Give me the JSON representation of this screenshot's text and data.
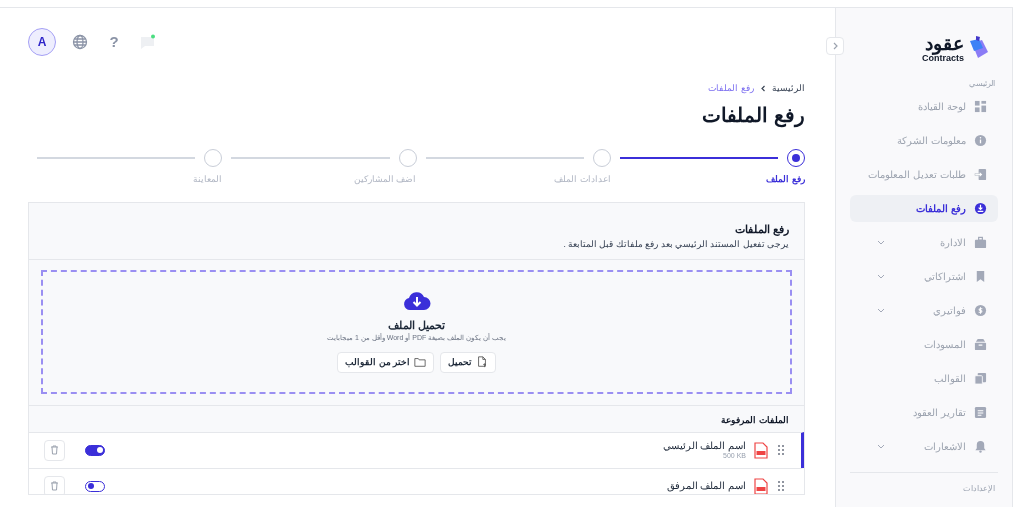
{
  "header": {
    "avatar": "A",
    "help": "?"
  },
  "breadcrumb": [
    {
      "label": "الرئيسية",
      "selected": false
    },
    {
      "label": "رفع الملفات",
      "selected": true
    }
  ],
  "title": "رفع الملفات",
  "steps": [
    {
      "label": "رفع الملف",
      "selected": true
    },
    {
      "label": "اعدادات الملف",
      "selected": false
    },
    {
      "label": "اضف المشاركين",
      "selected": false
    },
    {
      "label": "المعاينة",
      "selected": false
    }
  ],
  "upload_card": {
    "title": "رفع الملفات",
    "subtitle": "يرجى تفعيل المستند الرئيسي بعد رفع ملفاتك قبل المتابعة .",
    "dropzone": {
      "title": "تحميل الملف",
      "hint": "يجب أن يكون الملف بصيغة PDF أو Word وأقل من 1 ميجابايت",
      "buttons": [
        "تحميل",
        "اختر من القوالب"
      ]
    }
  },
  "uploaded": {
    "title": "الملفات المرفوعة",
    "files": [
      {
        "name": "اسم الملف الرئيسي",
        "size": "500 KB",
        "selected": true,
        "on": true
      },
      {
        "name": "اسم الملف المرفق",
        "selected": false,
        "on": false
      }
    ]
  },
  "sidebar": {
    "logo": {
      "name": "عقود",
      "tagline": "Contracts"
    },
    "section": "الرئيسي",
    "items": [
      {
        "label": "لوحة القيادة",
        "selected": false,
        "expandable": false
      },
      {
        "label": "معلومات الشركة",
        "selected": false,
        "expandable": false
      },
      {
        "label": "طلبات تعديل المعلومات",
        "selected": false,
        "expandable": false
      },
      {
        "label": "رفع الملفات",
        "selected": true,
        "expandable": false
      },
      {
        "label": "الادارة",
        "selected": false,
        "expandable": true
      },
      {
        "label": "اشتراكاتي",
        "selected": false,
        "expandable": true
      },
      {
        "label": "فواتيري",
        "selected": false,
        "expandable": true
      },
      {
        "label": "المسودات",
        "selected": false,
        "expandable": false
      },
      {
        "label": "القوالب",
        "selected": false,
        "expandable": false
      },
      {
        "label": "تقارير العقود",
        "selected": false,
        "expandable": false
      },
      {
        "label": "الاشعارات",
        "selected": false,
        "expandable": true
      }
    ],
    "section_2": "الإعدادات"
  }
}
